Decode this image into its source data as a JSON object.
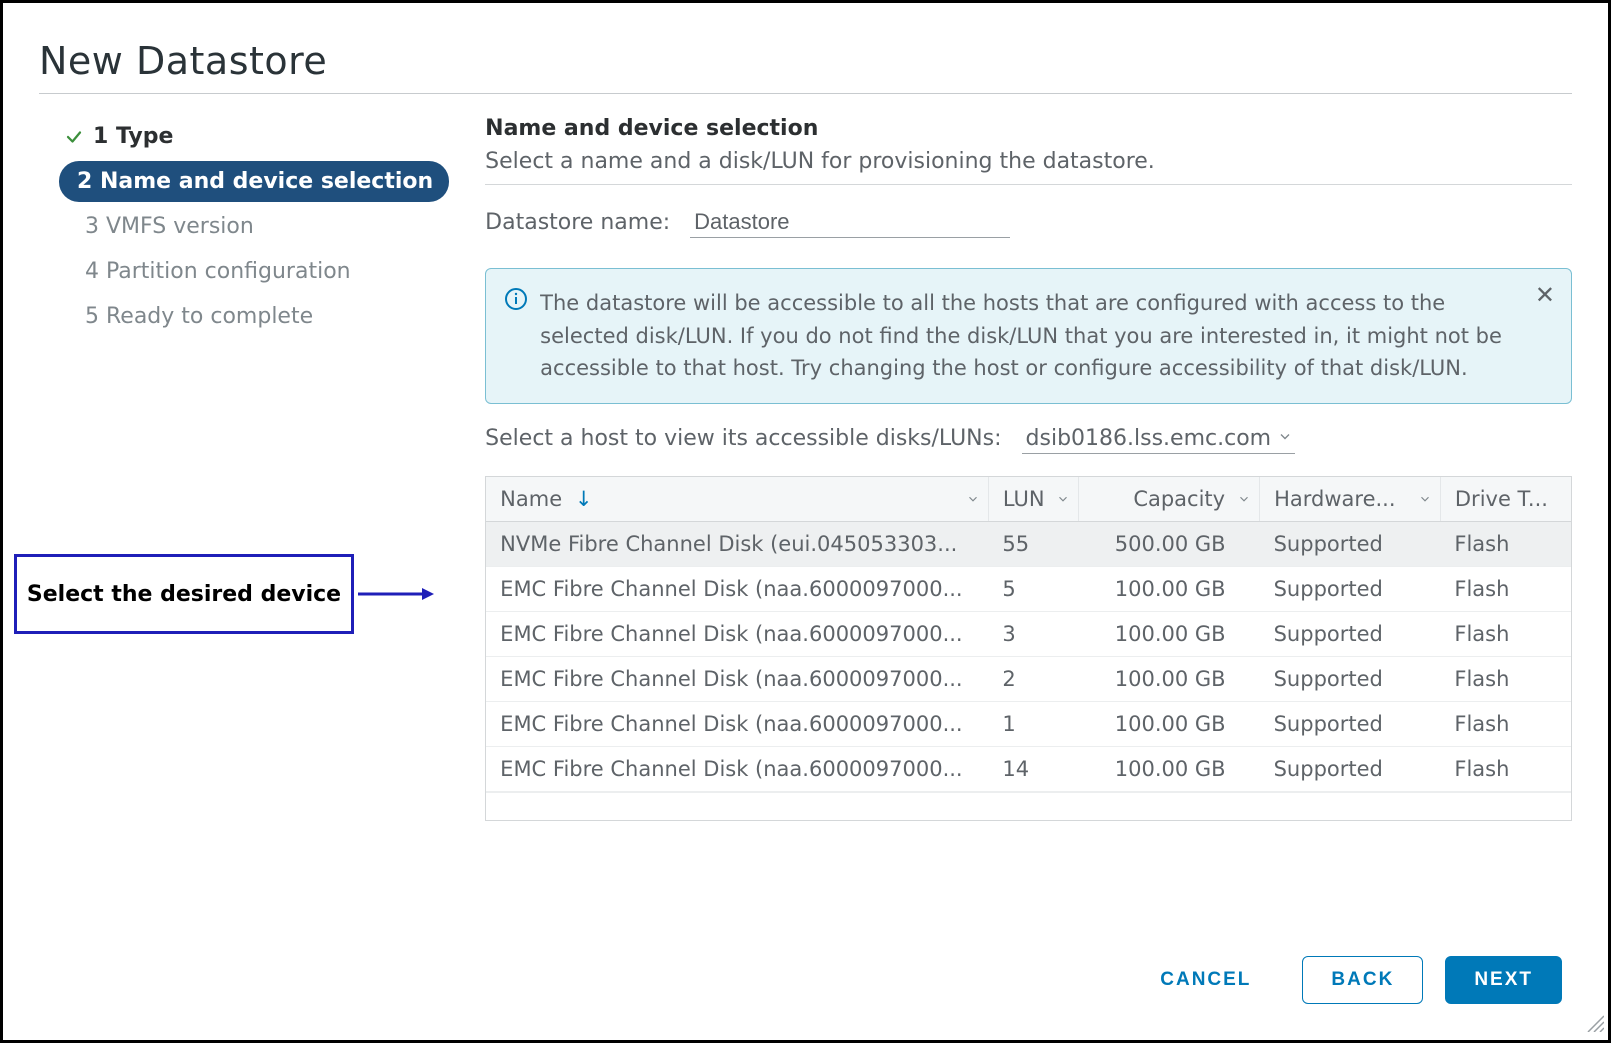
{
  "dialog": {
    "title": "New Datastore"
  },
  "wizard": {
    "steps": [
      {
        "label": "1 Type",
        "state": "done"
      },
      {
        "label": "2 Name and device selection",
        "state": "active"
      },
      {
        "label": "3 VMFS version",
        "state": "pending"
      },
      {
        "label": "4 Partition configuration",
        "state": "pending"
      },
      {
        "label": "5 Ready to complete",
        "state": "pending"
      }
    ]
  },
  "main": {
    "heading": "Name and device selection",
    "subheading": "Select a name and a disk/LUN for provisioning the datastore.",
    "datastore_name_label": "Datastore name:",
    "datastore_name_value": "Datastore",
    "info_text": "The datastore will be accessible to all the hosts that are configured with access to the selected disk/LUN. If you do not find the disk/LUN that you are interested in, it might not be accessible to that host. Try changing the host or configure accessibility of that disk/LUN.",
    "host_label": "Select a host to view its accessible disks/LUNs:",
    "host_value": "dsib0186.lss.emc.com"
  },
  "table": {
    "columns": {
      "name": "Name",
      "lun": "LUN",
      "capacity": "Capacity",
      "hardware": "Hardware...",
      "drive": "Drive T..."
    },
    "sort_indicator": "↓",
    "rows": [
      {
        "name": "NVMe Fibre Channel Disk (eui.045053303...",
        "lun": "55",
        "capacity": "500.00 GB",
        "hardware": "Supported",
        "drive": "Flash",
        "selected": true
      },
      {
        "name": "EMC Fibre Channel Disk (naa.6000097000...",
        "lun": "5",
        "capacity": "100.00 GB",
        "hardware": "Supported",
        "drive": "Flash",
        "selected": false
      },
      {
        "name": "EMC Fibre Channel Disk (naa.6000097000...",
        "lun": "3",
        "capacity": "100.00 GB",
        "hardware": "Supported",
        "drive": "Flash",
        "selected": false
      },
      {
        "name": "EMC Fibre Channel Disk (naa.6000097000...",
        "lun": "2",
        "capacity": "100.00 GB",
        "hardware": "Supported",
        "drive": "Flash",
        "selected": false
      },
      {
        "name": "EMC Fibre Channel Disk (naa.6000097000...",
        "lun": "1",
        "capacity": "100.00 GB",
        "hardware": "Supported",
        "drive": "Flash",
        "selected": false
      },
      {
        "name": "EMC Fibre Channel Disk (naa.6000097000...",
        "lun": "14",
        "capacity": "100.00 GB",
        "hardware": "Supported",
        "drive": "Flash",
        "selected": false
      }
    ]
  },
  "footer": {
    "cancel": "CANCEL",
    "back": "BACK",
    "next": "NEXT"
  },
  "annotation": {
    "callout_text": "Select the desired device"
  }
}
